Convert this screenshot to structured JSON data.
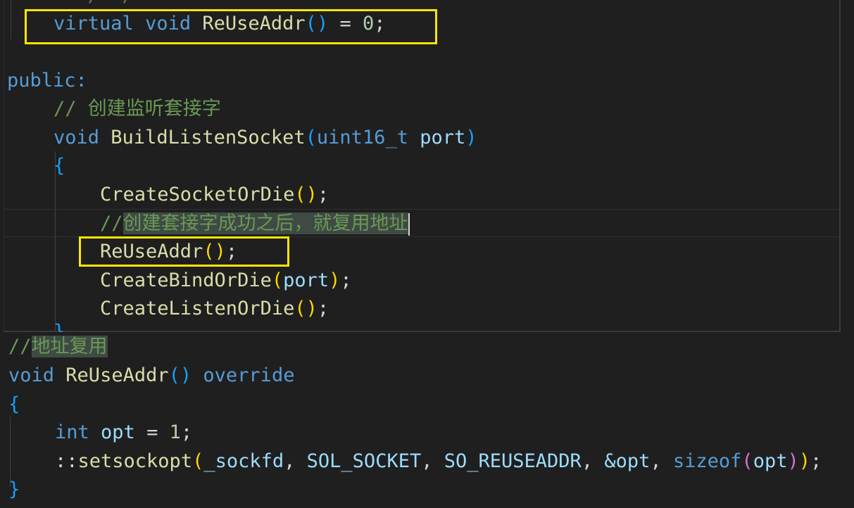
{
  "top_panel": {
    "cut_line": "   /  /   ",
    "line_virtual_kw": "virtual",
    "line_void_kw": "void",
    "line_fn": "ReUseAddr",
    "line_rest": " = ",
    "line_zero": "0",
    "public_label": "public:",
    "comment_build": "// 创建监听套接字",
    "build_void": "void",
    "build_fn": "BuildListenSocket",
    "build_type": "uint16_t",
    "build_param": "port",
    "open_brace": "{",
    "call_create_socket": "CreateSocketOrDie",
    "comment_reuse_prefix": "//",
    "comment_reuse_text": "创建套接字成功之后，就复用地址",
    "call_reuse": "ReUseAddr",
    "call_bind": "CreateBindOrDie",
    "call_bind_arg": "port",
    "call_listen": "CreateListenOrDie",
    "close_brace": "}"
  },
  "bottom_panel": {
    "comment_prefix": "//",
    "comment_text": "地址复用",
    "decl_void": "void",
    "decl_fn": "ReUseAddr",
    "decl_override": "override",
    "open_brace": "{",
    "int_kw": "int",
    "opt_var": "opt",
    "assign": " = ",
    "one": "1",
    "setsockopt_prefix": "::",
    "setsockopt_fn": "setsockopt",
    "sockfd": "_sockfd",
    "sol_socket": "SOL_SOCKET",
    "so_reuseaddr": "SO_REUSEADDR",
    "amp_opt": "&opt",
    "sizeof_kw": "sizeof",
    "sizeof_arg": "opt",
    "close_brace": "}"
  },
  "colors": {
    "highlight_box": "#ffe600",
    "background": "#1f1f1f"
  }
}
